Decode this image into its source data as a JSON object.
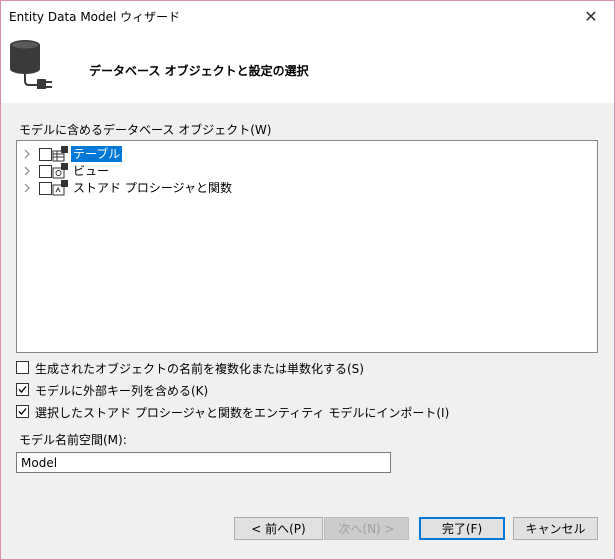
{
  "window": {
    "title": "Entity Data Model ウィザード",
    "close_glyph": "✕"
  },
  "header": {
    "title": "データベース オブジェクトと設定の選択"
  },
  "objects": {
    "label": "モデルに含めるデータベース オブジェクト(W)",
    "items": [
      {
        "label": "テーブル",
        "selected": true,
        "checked": false
      },
      {
        "label": "ビュー",
        "selected": false,
        "checked": false
      },
      {
        "label": "ストアド プロシージャと関数",
        "selected": false,
        "checked": false
      }
    ]
  },
  "options": [
    {
      "label": "生成されたオブジェクトの名前を複数化または単数化する(S)",
      "checked": false
    },
    {
      "label": "モデルに外部キー列を含める(K)",
      "checked": true
    },
    {
      "label": "選択したストアド プロシージャと関数をエンティティ モデルにインポート(I)",
      "checked": true
    }
  ],
  "namespace": {
    "label": "モデル名前空間(M):",
    "value": "Model"
  },
  "buttons": {
    "prev": "< 前へ(P)",
    "next": "次へ(N) >",
    "finish": "完了(F)",
    "cancel": "キャンセル"
  },
  "colors": {
    "selection": "#0078d7",
    "border": "#d98fb0"
  }
}
